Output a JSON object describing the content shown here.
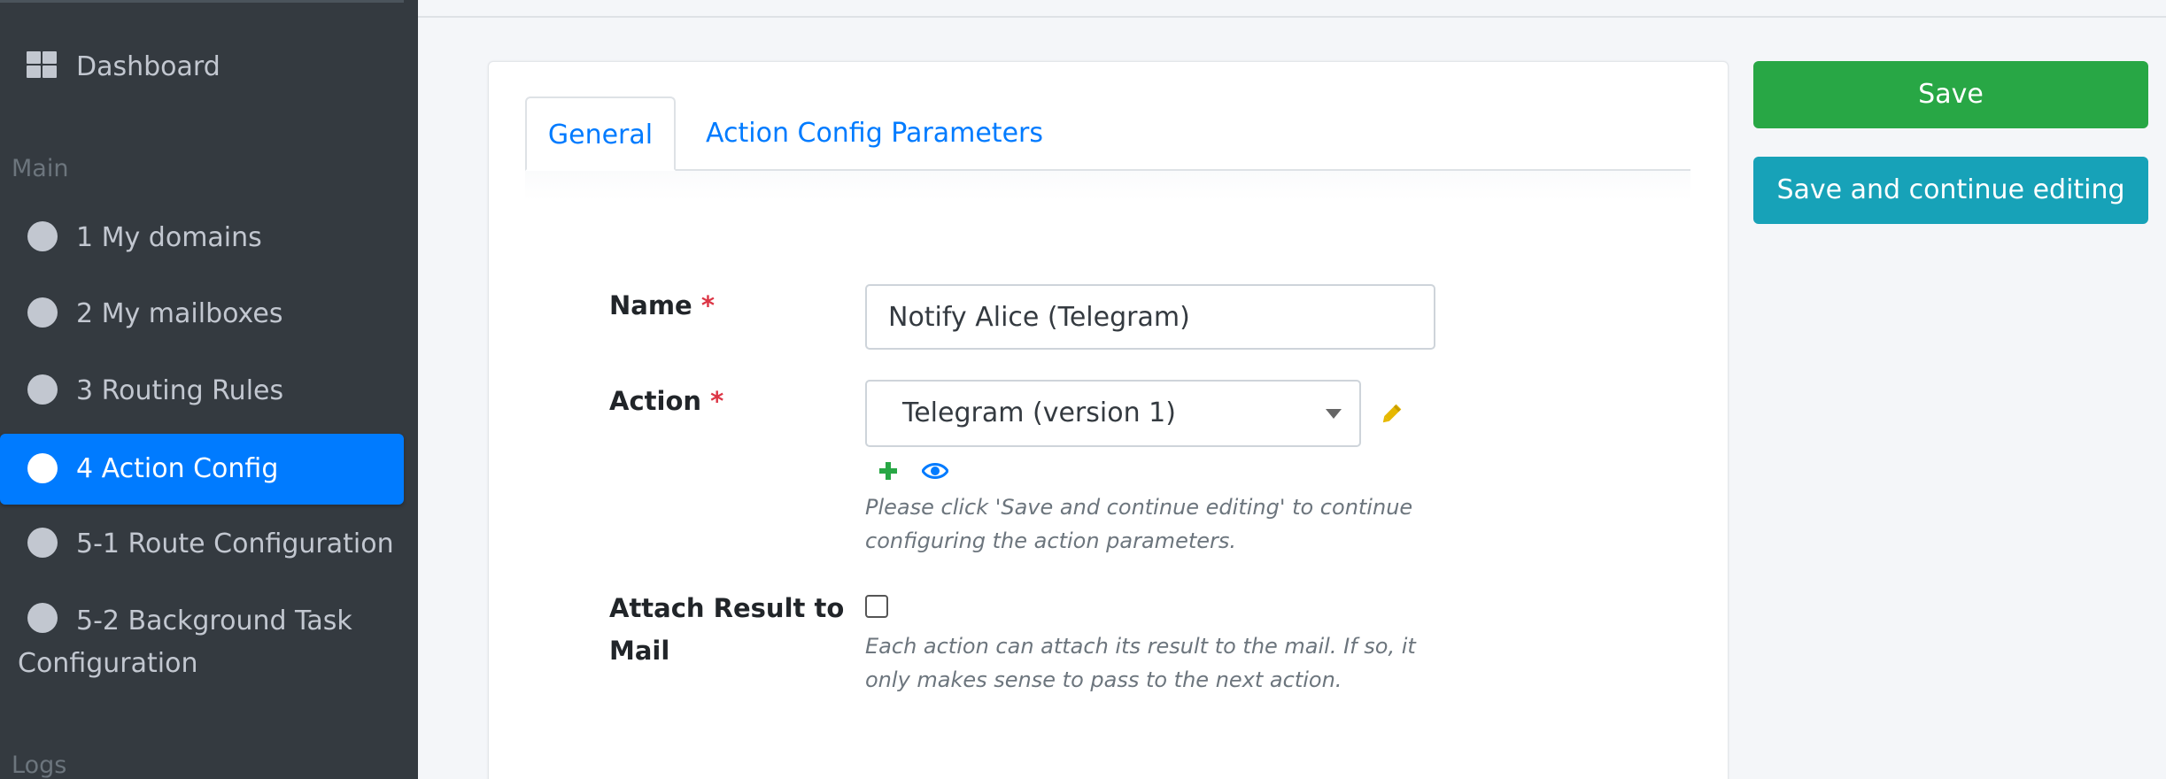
{
  "sidebar": {
    "dashboard_label": "Dashboard",
    "section_main": "Main",
    "items": [
      {
        "label": "1 My domains"
      },
      {
        "label": "2 My mailboxes"
      },
      {
        "label": "3 Routing Rules"
      },
      {
        "label": "4 Action Config"
      },
      {
        "label": "5-1 Route Configuration"
      },
      {
        "label_line1": "5-2 Background Task",
        "label_line2": "Configuration"
      }
    ],
    "section_logs": "Logs",
    "active_index": 3
  },
  "tabs": [
    {
      "label": "General"
    },
    {
      "label": "Action Config Parameters"
    }
  ],
  "form": {
    "name": {
      "label": "Name",
      "required_mark": "*",
      "value": "Notify Alice (Telegram)"
    },
    "action": {
      "label": "Action",
      "required_mark": "*",
      "selected": "Telegram (version 1)",
      "help": "Please click 'Save and continue editing' to continue configuring the action parameters."
    },
    "attach": {
      "label_line1": "Attach Result to",
      "label_line2": "Mail",
      "checked": false,
      "help": "Each action can attach its result to the mail. If so, it only makes sense to pass to the next action."
    }
  },
  "buttons": {
    "save": "Save",
    "save_continue": "Save and continue editing"
  },
  "colors": {
    "sidebar_bg": "#343a40",
    "active_item": "#007bff",
    "save_button": "#28a745",
    "continue_button": "#17a2b8",
    "required": "#dc3545",
    "edit_icon": "#e6b800",
    "add_icon": "#28a745",
    "view_icon": "#007bff"
  },
  "icons": {
    "dashboard": "grid-icon",
    "nav_item": "circle-icon",
    "edit": "pencil-icon",
    "add": "plus-icon",
    "view": "eye-icon"
  }
}
